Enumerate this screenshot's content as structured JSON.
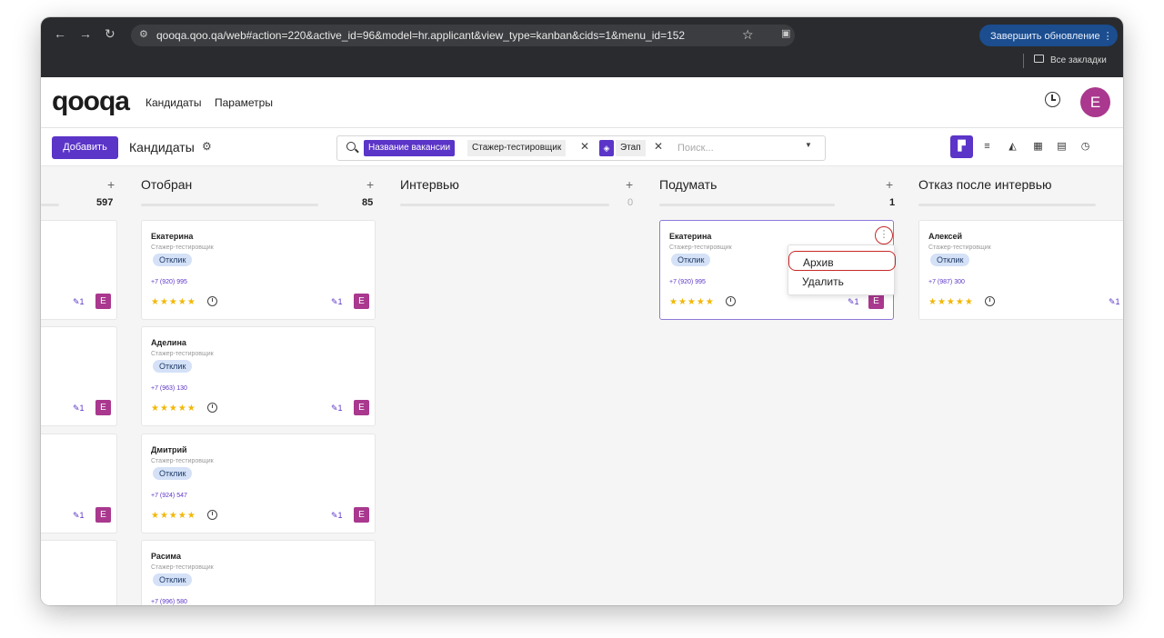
{
  "browser": {
    "url": "qooqa.qoo.qa/web#action=220&active_id=96&model=hr.applicant&view_type=kanban&cids=1&menu_id=152",
    "update_button": "Завершить обновление",
    "bookmarks_label": "Все закладки"
  },
  "app": {
    "logo": "qooqa",
    "menu": [
      "Кандидаты",
      "Параметры"
    ],
    "user_initial": "E"
  },
  "control_panel": {
    "add_button": "Добавить",
    "title": "Кандидаты",
    "search": {
      "facets": [
        {
          "label": "Название вакансии",
          "value": "Стажер-тестировщик"
        },
        {
          "label": "",
          "value": "Этап"
        }
      ],
      "placeholder": "Поиск..."
    },
    "views": [
      "kanban-view-icon",
      "list-view-icon",
      "graph-view-icon",
      "calendar-view-icon",
      "pivot-view-icon",
      "activity-view-icon"
    ]
  },
  "kanban": {
    "columns": [
      {
        "title": "",
        "count": "597"
      },
      {
        "title": "Отобран",
        "count": "85"
      },
      {
        "title": "Интервью",
        "count": "0"
      },
      {
        "title": "Подумать",
        "count": "1"
      },
      {
        "title": "Отказ после интервью",
        "count": ""
      }
    ],
    "left_partial_cards": [
      {
        "attachments": "1",
        "avatar": "E"
      },
      {
        "attachments": "1",
        "avatar": "E"
      },
      {
        "attachments": "1",
        "avatar": "E"
      }
    ],
    "selected_cards": [
      {
        "name": "Екатерина",
        "job": "Стажер-тестировщик",
        "tag": "Отклик",
        "phone": "+7 (920) 995",
        "attachments": "1",
        "avatar": "E"
      },
      {
        "name": "Аделина",
        "job": "Стажер-тестировщик",
        "tag": "Отклик",
        "phone": "+7 (963) 130",
        "attachments": "1",
        "avatar": "E"
      },
      {
        "name": "Дмитрий",
        "job": "Стажер-тестировщик",
        "tag": "Отклик",
        "phone": "+7 (924) 547",
        "attachments": "1",
        "avatar": "E"
      },
      {
        "name": "Расима",
        "job": "Стажер-тестировщик",
        "tag": "Отклик",
        "phone": "+7 (996) 580",
        "attachments": "",
        "avatar": ""
      }
    ],
    "think_card": {
      "name": "Екатерина",
      "job": "Стажер-тестировщик",
      "tag": "Отклик",
      "phone": "+7 (920) 995",
      "attachments": "1",
      "avatar": "E"
    },
    "refused_card": {
      "name": "Алексей",
      "job": "Стажер-тестировщик",
      "tag": "Отклик",
      "phone": "+7 (987) 300",
      "attachments": "1"
    },
    "dropdown": [
      "Архив",
      "Удалить"
    ],
    "stars": "★★★★★"
  },
  "colors": {
    "primary": "#5b34c8",
    "avatar": "#a9388e",
    "stars": "#f2b807",
    "highlight": "#c62828"
  }
}
